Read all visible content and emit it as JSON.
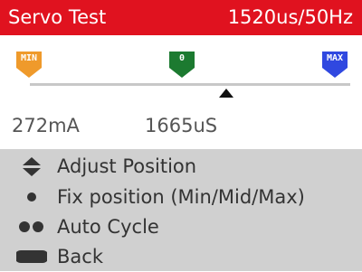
{
  "header": {
    "title": "Servo Test",
    "pulse_rate": "1520us/50Hz",
    "background_color": "#e0121f"
  },
  "position_markers": {
    "min_label": "MIN",
    "mid_label": "0",
    "max_label": "MAX",
    "min_color": "#ef9a2b",
    "mid_color": "#1c7a30",
    "max_color": "#3048e0"
  },
  "position_indicator": {
    "icon": "triangle-up-pointer"
  },
  "readings": {
    "current": "272mA",
    "pulse_width": "1665uS"
  },
  "menu": {
    "items": [
      {
        "icon": "up-down-arrows-icon",
        "label": "Adjust Position"
      },
      {
        "icon": "single-dot-icon",
        "label": "Fix position (Min/Mid/Max)"
      },
      {
        "icon": "double-dot-icon",
        "label": "Auto Cycle"
      },
      {
        "icon": "long-press-bar-icon",
        "label": "Back"
      }
    ]
  }
}
